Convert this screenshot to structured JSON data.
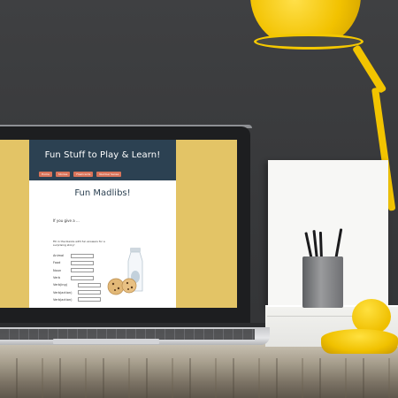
{
  "site": {
    "title": "Fun Stuff to Play & Learn!",
    "nav": [
      "Home",
      "Stories",
      "Flashcards",
      "Number Sense"
    ],
    "page_heading": "Fun Madlibs!",
    "intro": "If you give a ...",
    "instructions": "Fill in the blanks with fun answers for a surprising story!",
    "form_fields": [
      "Animal",
      "Food",
      "Noun",
      "Verb",
      "Verb(ing)",
      "Verb(action)",
      "Verb(action)"
    ]
  },
  "colors": {
    "site_background": "#e3c466",
    "header": "#2c4152",
    "nav_button": "#d9745a",
    "lamp": "#f2c400"
  }
}
